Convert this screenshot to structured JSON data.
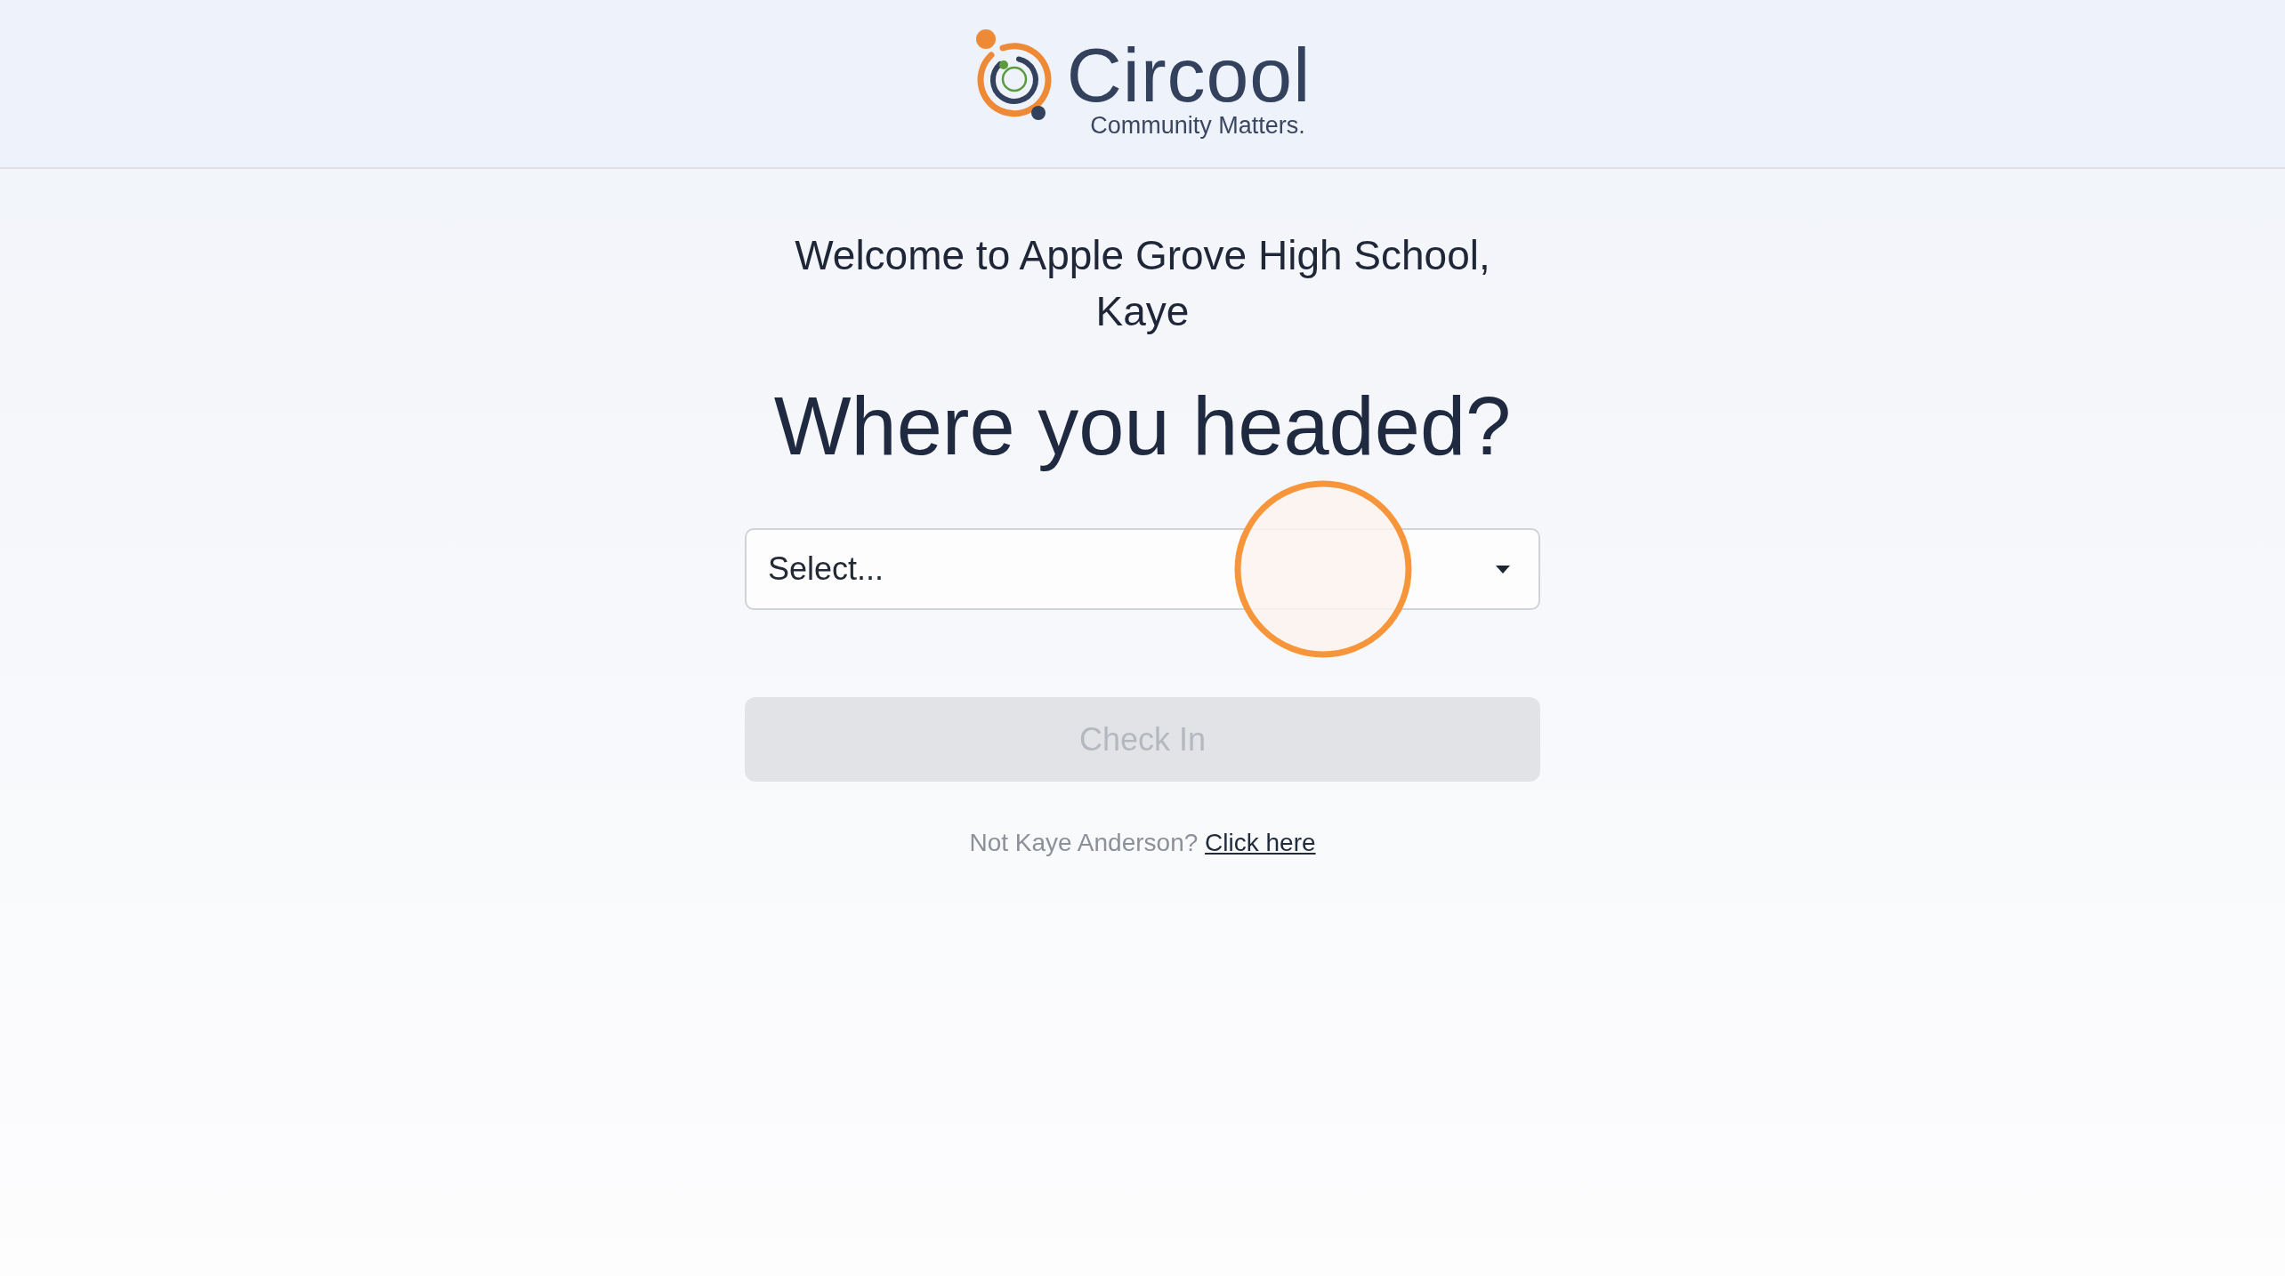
{
  "header": {
    "brand_name": "Circool",
    "tagline": "Community Matters."
  },
  "greeting": "Welcome to Apple Grove High School, Kaye",
  "question": "Where you headed?",
  "destination_select": {
    "placeholder": "Select..."
  },
  "check_in_button": {
    "label": "Check In",
    "disabled": true
  },
  "switch_user": {
    "prompt": "Not Kaye Anderson?",
    "link": "Click here"
  }
}
